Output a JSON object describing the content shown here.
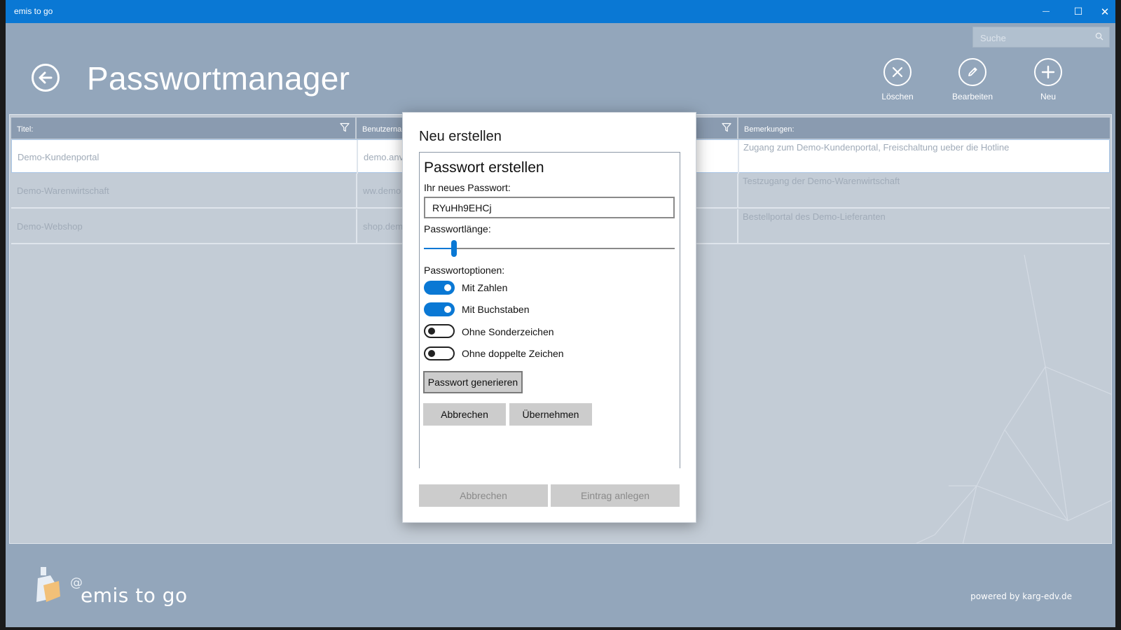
{
  "window": {
    "title": "emis to go",
    "minimize_glyph": "—",
    "maximize_glyph": "☐",
    "close_glyph": "✕"
  },
  "header": {
    "page_title": "Passwortmanager",
    "search_placeholder": "Suche",
    "actions": [
      {
        "label": "Löschen",
        "icon": "close-circle-icon"
      },
      {
        "label": "Bearbeiten",
        "icon": "pencil-icon"
      },
      {
        "label": "Neu",
        "icon": "plus-icon"
      }
    ]
  },
  "grid": {
    "columns": [
      "Titel:",
      "Benutzerna",
      "",
      "Bemerkungen:"
    ],
    "rows": [
      {
        "title": "Demo-Kundenportal",
        "user": "demo.anv",
        "remark": "Zugang zum Demo-Kundenportal, Freischaltung ueber die Hotline"
      },
      {
        "title": "Demo-Warenwirtschaft",
        "user": "ww.demo",
        "remark": "Testzugang der Demo-Warenwirtschaft"
      },
      {
        "title": "Demo-Webshop",
        "user": "shop.dem",
        "remark": "Bestellportal des Demo-Lieferanten"
      }
    ]
  },
  "dialog": {
    "title": "Neu erstellen",
    "section_title": "Passwort erstellen",
    "password_label": "Ihr neues Passwort:",
    "password_value": "RYuHh9EHCj",
    "length_label": "Passwortlänge:",
    "length_level": 0.12,
    "options_label": "Passwortoptionen:",
    "options": [
      {
        "label": "Mit Zahlen",
        "on": true
      },
      {
        "label": "Mit Buchstaben",
        "on": true
      },
      {
        "label": "Ohne Sonderzeichen",
        "on": false
      },
      {
        "label": "Ohne doppelte Zeichen",
        "on": false
      }
    ],
    "generate_label": "Passwort generieren",
    "inner_cancel": "Abbrechen",
    "inner_apply": "Übernehmen",
    "outer_cancel": "Abbrechen",
    "outer_create": "Eintrag anlegen"
  },
  "footer": {
    "brand": "emis to go",
    "powered_by": "powered by karg-edv.de"
  },
  "colors": {
    "titlebar": "#0a78d4",
    "background": "#93a6bb",
    "accent": "#0a78d4"
  }
}
